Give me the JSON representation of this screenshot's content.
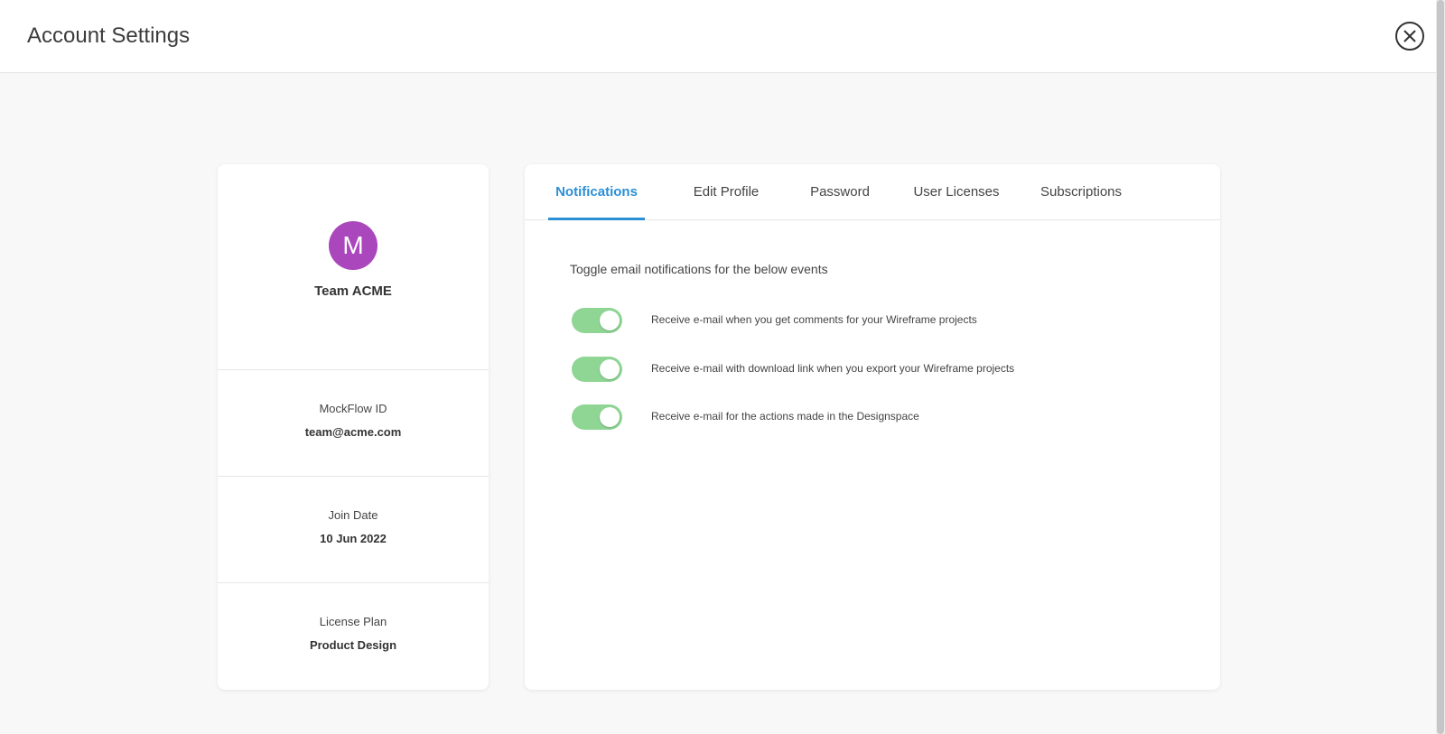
{
  "header": {
    "title": "Account Settings"
  },
  "profile": {
    "avatar_letter": "M",
    "avatar_color": "#ab47bc",
    "name": "Team ACME",
    "fields": [
      {
        "label": "MockFlow ID",
        "value": "team@acme.com"
      },
      {
        "label": "Join Date",
        "value": "10 Jun 2022"
      },
      {
        "label": "License Plan",
        "value": "Product Design"
      }
    ]
  },
  "tabs": [
    {
      "label": "Notifications",
      "active": true
    },
    {
      "label": "Edit Profile",
      "active": false
    },
    {
      "label": "Password",
      "active": false
    },
    {
      "label": "User Licenses",
      "active": false
    },
    {
      "label": "Subscriptions",
      "active": false
    }
  ],
  "notifications": {
    "intro": "Toggle email notifications for the below events",
    "items": [
      {
        "label": "Receive e-mail when you get comments for your Wireframe projects",
        "enabled": true
      },
      {
        "label": "Receive e-mail with download link when you export your Wireframe projects",
        "enabled": true
      },
      {
        "label": "Receive e-mail for the actions made in the Designspace",
        "enabled": true
      }
    ]
  },
  "colors": {
    "accent": "#2b8fd6",
    "toggle_on": "#8fd694"
  },
  "icons": {
    "close": "close-circle-icon"
  }
}
